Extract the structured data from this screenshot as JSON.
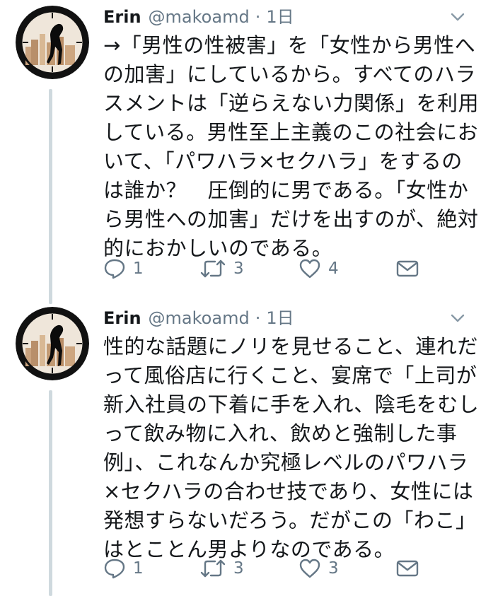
{
  "tweets": [
    {
      "name": "Erin",
      "handle": "@makoamd",
      "separator": "·",
      "time": "1日",
      "lines": [
        "→「男性の性被害」を「女性から男性へ",
        "の加害」にしているから。すべてのハラ",
        "スメントは「逆らえない力関係」を利用",
        "している。男性至上主義のこの社会にお",
        "いて、「パワハラ×セクハラ」をするの",
        "は誰か？　圧倒的に男である。「女性か",
        "ら男性への加害」だけを出すのが、絶対",
        "的におかしいのである。"
      ],
      "reply_count": "1",
      "retweet_count": "3",
      "like_count": "4"
    },
    {
      "name": "Erin",
      "handle": "@makoamd",
      "separator": "·",
      "time": "1日",
      "lines": [
        "性的な話題にノリを見せること、連れだ",
        "って風俗店に行くこと、宴席で「上司が",
        "新入社員の下着に手を入れ、陰毛をむし",
        "って飲み物に入れ、飲めと強制した事",
        "例」、これなんか究極レベルのパワハラ",
        "×セクハラの合わせ技であり、女性には",
        "発想すらないだろう。だがこの「わこ」",
        "はとことん男よりなのである。"
      ],
      "reply_count": "1",
      "retweet_count": "3",
      "like_count": "3"
    }
  ],
  "icons": {
    "reply": "reply-icon",
    "retweet": "retweet-icon",
    "like": "heart-icon",
    "dm": "envelope-icon",
    "menu": "chevron-down-icon"
  },
  "colors": {
    "text": "#14171a",
    "secondary": "#657786",
    "thread_line": "#cfd9de"
  }
}
